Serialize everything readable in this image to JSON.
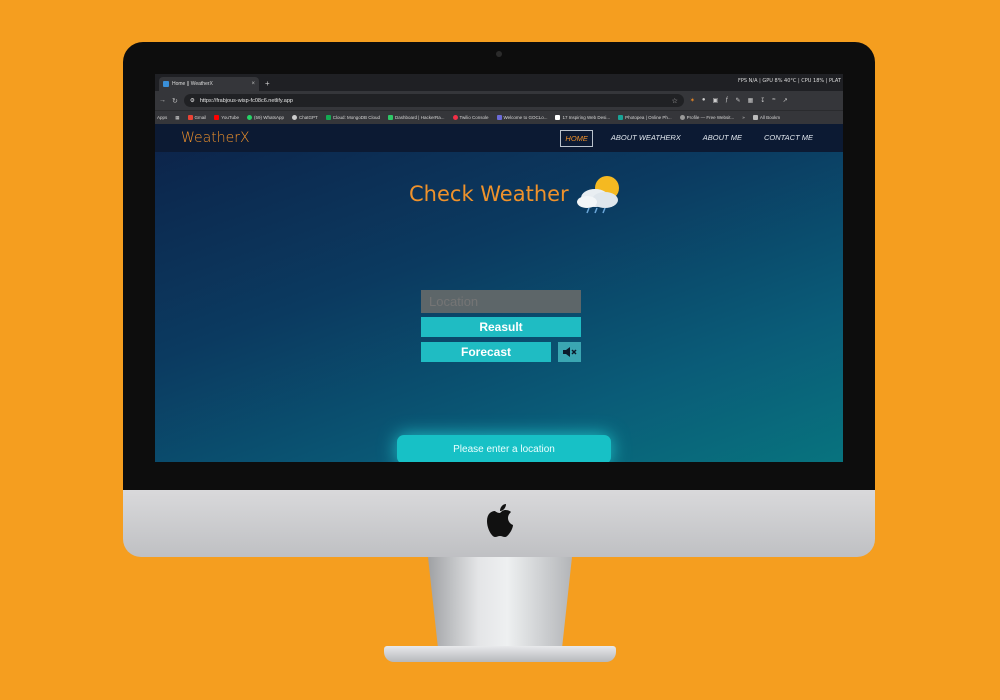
{
  "browser": {
    "tab_title": "Home || WeatherX",
    "tab_close": "×",
    "new_tab": "+",
    "system_stats": "FPS N/A | GPU 8% 40°C | CPU 18% | PLAT",
    "url": "https://frabjous-wisp-fc08c6.netlify.app",
    "bookmarks": [
      {
        "label": "Apps",
        "color": ""
      },
      {
        "label": "Gmail",
        "color": "#ea4335"
      },
      {
        "label": "YouTube",
        "color": "#ff0000"
      },
      {
        "label": "(59) WhatsApp",
        "color": "#25d366"
      },
      {
        "label": "ChatGPT",
        "color": "#cccccc"
      },
      {
        "label": "Cloud: MongoDB Cloud",
        "color": "#13aa52"
      },
      {
        "label": "Dashboard | HackerRa...",
        "color": "#2ec866"
      },
      {
        "label": "Twilio Console",
        "color": "#f22f46"
      },
      {
        "label": "Welcome to GOCLo...",
        "color": "#6b6bd9"
      },
      {
        "label": "17 Inspiring Web Desi...",
        "color": "#ffffff"
      },
      {
        "label": "Photopea | Online Ph...",
        "color": "#18a497"
      },
      {
        "label": "Profile — Free Websit...",
        "color": "#999999"
      }
    ],
    "bookmarks_more": "»",
    "all_bookmarks": "All Bookm"
  },
  "site": {
    "brand": "WeatherX",
    "nav": [
      {
        "label": "HOME",
        "active": true
      },
      {
        "label": "ABOUT WEATHERX",
        "active": false
      },
      {
        "label": "ABOUT ME",
        "active": false
      },
      {
        "label": "CONTACT ME",
        "active": false
      }
    ],
    "heading": "Check Weather",
    "location_placeholder": "Location",
    "result_button": "Reasult",
    "forecast_button": "Forecast",
    "mute_icon": "speaker-muted-icon",
    "message": "Please enter a location"
  },
  "colors": {
    "background": "#f59e1f",
    "accent": "#f0922b",
    "button": "#1fbcc3"
  }
}
